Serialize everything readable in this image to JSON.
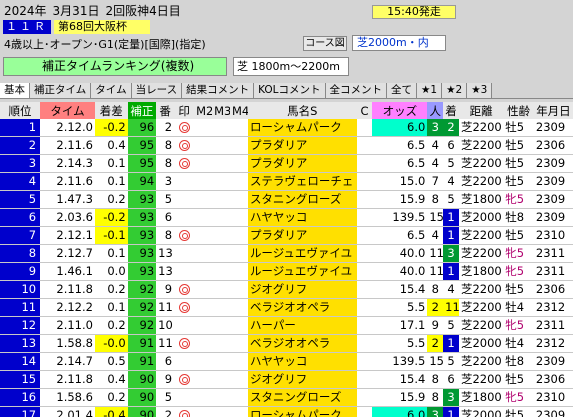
{
  "header": {
    "date": "2024年",
    "month_day": "3月31日",
    "meeting": "2回阪神4日目",
    "race_no": "１１Ｒ",
    "race_name": "第68回大阪杯",
    "start_time": "15:40発走",
    "condition": "4歳以上･オープン･G1(定量)[国際](指定)",
    "course_button": "コース図",
    "course": "芝2000m・内"
  },
  "toolbar": {
    "ranking_label": "補正タイムランキング(複数)",
    "range": "芝 1800m〜2200m"
  },
  "tabs": [
    "基本",
    "補正タイム",
    "タイム",
    "当レース",
    "結果コメント",
    "KOLコメント",
    "全コメント",
    "全て",
    "★1",
    "★2",
    "★3"
  ],
  "columns": [
    "順位",
    "タイム",
    "着差",
    "補正",
    "番",
    "印",
    "M2",
    "M3",
    "M4",
    "馬名S",
    "C",
    "オッズ",
    "人",
    "着",
    "距離",
    "性齢",
    "年月日"
  ],
  "rows": [
    {
      "rank": "1",
      "time": "2.12.0",
      "diff": "-0.2",
      "hosei": "96",
      "ban": "2",
      "mark": true,
      "name": "ローシャムパーク",
      "odds": "6.0",
      "pop": "3",
      "chaku": "2",
      "dist": "芝2200",
      "sex": "牡5",
      "date": "2309"
    },
    {
      "rank": "2",
      "time": "2.11.6",
      "diff": "0.4",
      "hosei": "95",
      "ban": "8",
      "mark": true,
      "name": "プラダリア",
      "odds": "6.5",
      "pop": "4",
      "chaku": "6",
      "dist": "芝2200",
      "sex": "牡5",
      "date": "2306"
    },
    {
      "rank": "3",
      "time": "2.14.3",
      "diff": "0.1",
      "hosei": "95",
      "ban": "8",
      "mark": true,
      "name": "プラダリア",
      "odds": "6.5",
      "pop": "4",
      "chaku": "5",
      "dist": "芝2200",
      "sex": "牡5",
      "date": "2309"
    },
    {
      "rank": "4",
      "time": "2.11.6",
      "diff": "0.1",
      "hosei": "94",
      "ban": "3",
      "mark": false,
      "name": "ステラヴェローチェ",
      "odds": "15.0",
      "pop": "7",
      "chaku": "4",
      "dist": "芝2200",
      "sex": "牡5",
      "date": "2309"
    },
    {
      "rank": "5",
      "time": "1.47.3",
      "diff": "0.2",
      "hosei": "93",
      "ban": "5",
      "mark": false,
      "name": "スタニングローズ",
      "odds": "15.9",
      "pop": "8",
      "chaku": "5",
      "dist": "芝1800",
      "sex": "牝5",
      "date": "2309"
    },
    {
      "rank": "6",
      "time": "2.03.6",
      "diff": "-0.2",
      "hosei": "93",
      "ban": "6",
      "mark": false,
      "name": "ハヤヤッコ",
      "odds": "139.5",
      "pop": "15",
      "chaku": "1",
      "dist": "芝2000",
      "sex": "牡8",
      "date": "2309"
    },
    {
      "rank": "7",
      "time": "2.12.1",
      "diff": "-0.1",
      "hosei": "93",
      "ban": "8",
      "mark": true,
      "name": "プラダリア",
      "odds": "6.5",
      "pop": "4",
      "chaku": "1",
      "dist": "芝2200",
      "sex": "牡5",
      "date": "2310"
    },
    {
      "rank": "8",
      "time": "2.12.7",
      "diff": "0.1",
      "hosei": "93",
      "ban": "13",
      "mark": false,
      "name": "ルージュエヴァイユ",
      "odds": "40.0",
      "pop": "11",
      "chaku": "3",
      "dist": "芝2200",
      "sex": "牝5",
      "date": "2311"
    },
    {
      "rank": "9",
      "time": "1.46.1",
      "diff": "0.0",
      "hosei": "93",
      "ban": "13",
      "mark": false,
      "name": "ルージュエヴァイユ",
      "odds": "40.0",
      "pop": "11",
      "chaku": "1",
      "dist": "芝1800",
      "sex": "牝5",
      "date": "2311"
    },
    {
      "rank": "10",
      "time": "2.11.8",
      "diff": "0.2",
      "hosei": "92",
      "ban": "9",
      "mark": true,
      "name": "ジオグリフ",
      "odds": "15.4",
      "pop": "8",
      "chaku": "4",
      "dist": "芝2200",
      "sex": "牡5",
      "date": "2306"
    },
    {
      "rank": "11",
      "time": "2.12.2",
      "diff": "0.1",
      "hosei": "92",
      "ban": "11",
      "mark": true,
      "name": "ベラジオオペラ",
      "odds": "5.5",
      "pop": "2",
      "chaku": "11",
      "dist": "芝2200",
      "sex": "牡4",
      "date": "2312"
    },
    {
      "rank": "12",
      "time": "2.11.0",
      "diff": "0.2",
      "hosei": "92",
      "ban": "10",
      "mark": false,
      "name": "ハーパー",
      "odds": "17.1",
      "pop": "9",
      "chaku": "5",
      "dist": "芝2200",
      "sex": "牝5",
      "date": "2311"
    },
    {
      "rank": "13",
      "time": "1.58.8",
      "diff": "-0.0",
      "hosei": "91",
      "ban": "11",
      "mark": true,
      "name": "ベラジオオペラ",
      "odds": "5.5",
      "pop": "2",
      "chaku": "1",
      "dist": "芝2000",
      "sex": "牡4",
      "date": "2312"
    },
    {
      "rank": "14",
      "time": "2.14.7",
      "diff": "0.5",
      "hosei": "91",
      "ban": "6",
      "mark": false,
      "name": "ハヤヤッコ",
      "odds": "139.5",
      "pop": "15",
      "chaku": "5",
      "dist": "芝2200",
      "sex": "牡8",
      "date": "2309"
    },
    {
      "rank": "15",
      "time": "2.11.8",
      "diff": "0.4",
      "hosei": "90",
      "ban": "9",
      "mark": true,
      "name": "ジオグリフ",
      "odds": "15.4",
      "pop": "8",
      "chaku": "6",
      "dist": "芝2200",
      "sex": "牡5",
      "date": "2306"
    },
    {
      "rank": "16",
      "time": "1.58.6",
      "diff": "0.2",
      "hosei": "90",
      "ban": "5",
      "mark": false,
      "name": "スタニングローズ",
      "odds": "15.9",
      "pop": "8",
      "chaku": "3",
      "dist": "芝1800",
      "sex": "牝5",
      "date": "2310"
    },
    {
      "rank": "17",
      "time": "2.01.4",
      "diff": "-0.4",
      "hosei": "90",
      "ban": "2",
      "mark": true,
      "name": "ローシャムパーク",
      "odds": "6.0",
      "pop": "3",
      "chaku": "1",
      "dist": "芝2000",
      "sex": "牡5",
      "date": "2309"
    }
  ]
}
